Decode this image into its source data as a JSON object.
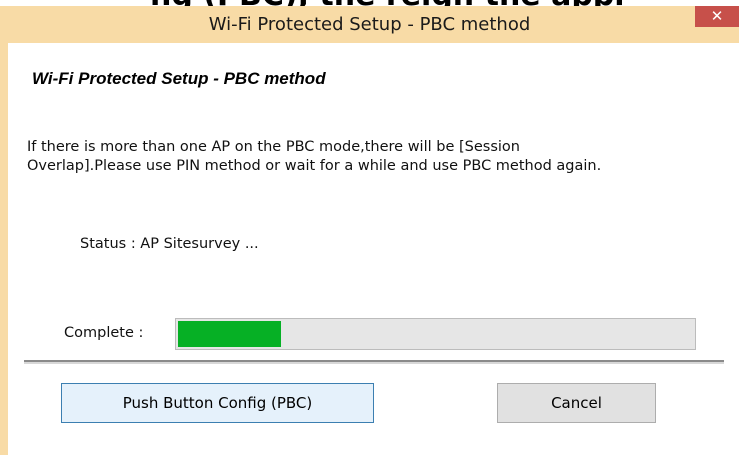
{
  "background": {
    "partial_text": "ng (PBC), the reigh the appl"
  },
  "window": {
    "title": "Wi-Fi Protected Setup - PBC method",
    "close_glyph": "✕",
    "close_icon": "close-icon",
    "titlebar_color": "#f8dba6",
    "close_color": "#c7504a"
  },
  "content": {
    "heading": "Wi-Fi Protected Setup - PBC method",
    "info_lines": [
      "If there is more than one AP on the PBC mode,there will be [Session",
      "Overlap].Please use PIN method or wait for a while and use PBC method again."
    ],
    "status": "Status : AP Sitesurvey ...",
    "complete_label": "Complete :",
    "progress_fraction": 0.2,
    "progress_color": "#06b025"
  },
  "buttons": {
    "pbc": "Push Button Config (PBC)",
    "cancel": "Cancel"
  }
}
